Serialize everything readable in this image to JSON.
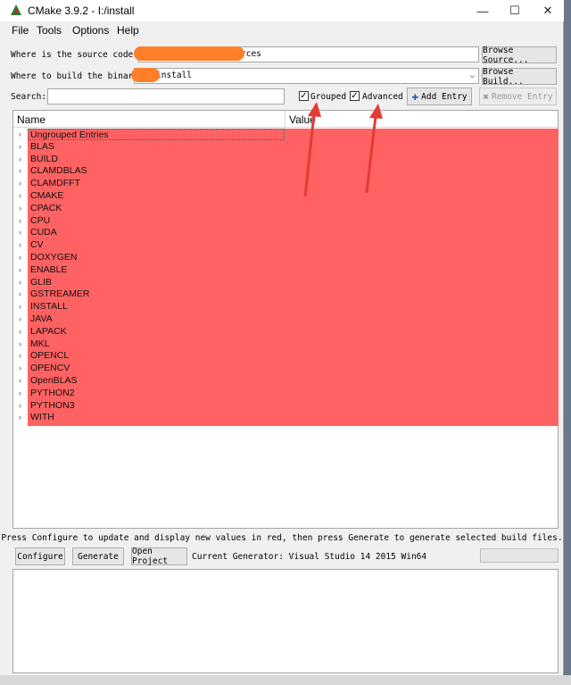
{
  "window": {
    "title": "CMake 3.9.2 - I:/install"
  },
  "title_buttons": {
    "minimize": "—",
    "maximize": "☐",
    "close": "✕"
  },
  "menu": [
    "File",
    "Tools",
    "Options",
    "Help"
  ],
  "source": {
    "label": "Where is the source code:",
    "value": "rces",
    "browse": "Browse Source..."
  },
  "build": {
    "label": "Where to build the binaries:",
    "value": "install",
    "browse": "Browse Build..."
  },
  "search": {
    "label": "Search:",
    "value": ""
  },
  "options": {
    "grouped": "Grouped",
    "grouped_checked": true,
    "advanced": "Advanced",
    "advanced_checked": true
  },
  "buttons": {
    "add_entry": "Add Entry",
    "remove_entry": "Remove Entry"
  },
  "tree": {
    "headers": {
      "name": "Name",
      "value": "Value"
    },
    "items": [
      "Ungrouped Entries",
      "BLAS",
      "BUILD",
      "CLAMDBLAS",
      "CLAMDFFT",
      "CMAKE",
      "CPACK",
      "CPU",
      "CUDA",
      "CV",
      "DOXYGEN",
      "ENABLE",
      "GLIB",
      "GSTREAMER",
      "INSTALL",
      "JAVA",
      "LAPACK",
      "MKL",
      "OPENCL",
      "OPENCV",
      "OpenBLAS",
      "PYTHON2",
      "PYTHON3",
      "WITH"
    ]
  },
  "message": "Press Configure to update and display new values in red, then press Generate to generate selected build files.",
  "actions": {
    "configure": "Configure",
    "generate": "Generate",
    "open_project": "Open Project"
  },
  "generator": "Current Generator: Visual Studio 14 2015 Win64",
  "colors": {
    "highlight": "#ff6262",
    "annotation_arrow": "#e53935",
    "redaction": "#ff7f2a"
  }
}
